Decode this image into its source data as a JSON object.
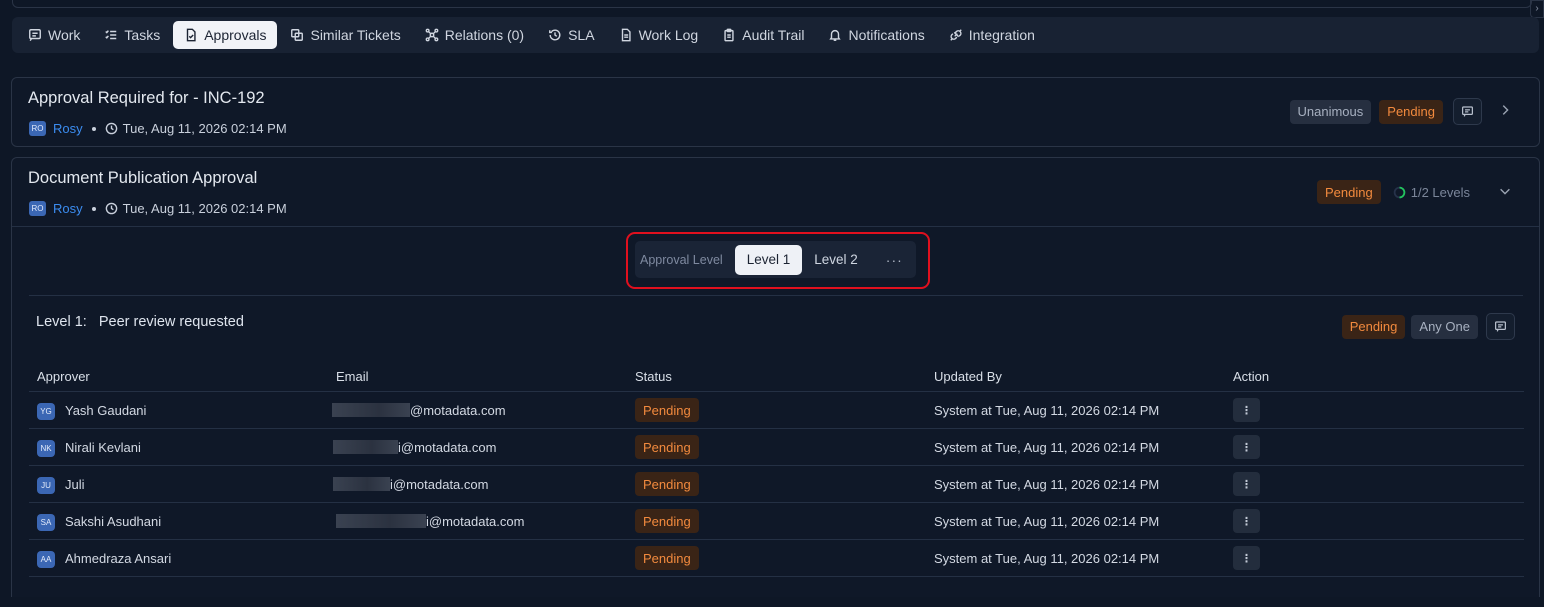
{
  "tabs": [
    {
      "label": "Work",
      "icon": "comment-lines-icon",
      "active": false
    },
    {
      "label": "Tasks",
      "icon": "checklist-icon",
      "active": false
    },
    {
      "label": "Approvals",
      "icon": "document-check-icon",
      "active": true
    },
    {
      "label": "Similar Tickets",
      "icon": "copy-icon",
      "active": false
    },
    {
      "label": "Relations (0)",
      "icon": "network-icon",
      "active": false
    },
    {
      "label": "SLA",
      "icon": "history-icon",
      "active": false
    },
    {
      "label": "Work Log",
      "icon": "document-icon",
      "active": false
    },
    {
      "label": "Audit Trail",
      "icon": "clipboard-icon",
      "active": false
    },
    {
      "label": "Notifications",
      "icon": "bell-icon",
      "active": false
    },
    {
      "label": "Integration",
      "icon": "plug-icon",
      "active": false
    }
  ],
  "approval1": {
    "title": "Approval Required for - INC-192",
    "user_initials": "RO",
    "user": "Rosy",
    "timestamp": "Tue, Aug 11, 2026 02:14 PM",
    "type_badge": "Unanimous",
    "status": "Pending"
  },
  "approval2": {
    "title": "Document Publication Approval",
    "user_initials": "RO",
    "user": "Rosy",
    "timestamp": "Tue, Aug 11, 2026 02:14 PM",
    "status": "Pending",
    "levels_progress": "1/2 Levels",
    "level_selector": {
      "label": "Approval Level",
      "levels": [
        "Level 1",
        "Level 2"
      ],
      "active": "Level 1",
      "more": "···"
    },
    "level_detail": {
      "prefix": "Level 1:",
      "name": "Peer review requested",
      "status": "Pending",
      "rule": "Any One"
    },
    "table": {
      "headers": [
        "Approver",
        "Email",
        "Status",
        "Updated By",
        "Action"
      ],
      "rows": [
        {
          "initials": "YG",
          "name": "Yash Gaudani",
          "email_visible": "@motadata.com",
          "status": "Pending",
          "updated_by": "System at Tue, Aug 11, 2026 02:14 PM"
        },
        {
          "initials": "NK",
          "name": "Nirali Kevlani",
          "email_visible": "i@motadata.com",
          "status": "Pending",
          "updated_by": "System at Tue, Aug 11, 2026 02:14 PM"
        },
        {
          "initials": "JU",
          "name": "Juli",
          "email_visible": "i@motadata.com",
          "status": "Pending",
          "updated_by": "System at Tue, Aug 11, 2026 02:14 PM"
        },
        {
          "initials": "SA",
          "name": "Sakshi Asudhani",
          "email_visible": "i@motadata.com",
          "status": "Pending",
          "updated_by": "System at Tue, Aug 11, 2026 02:14 PM"
        },
        {
          "initials": "AA",
          "name": "Ahmedraza Ansari",
          "email_visible": "",
          "status": "Pending",
          "updated_by": "System at Tue, Aug 11, 2026 02:14 PM"
        }
      ],
      "action_glyph": "⋮"
    }
  },
  "colors": {
    "background": "#0e1726",
    "pending_text": "#f28a3e",
    "pending_bg": "#3a2416",
    "user_link": "#3b8cf0",
    "highlight_box": "#e0101e"
  }
}
